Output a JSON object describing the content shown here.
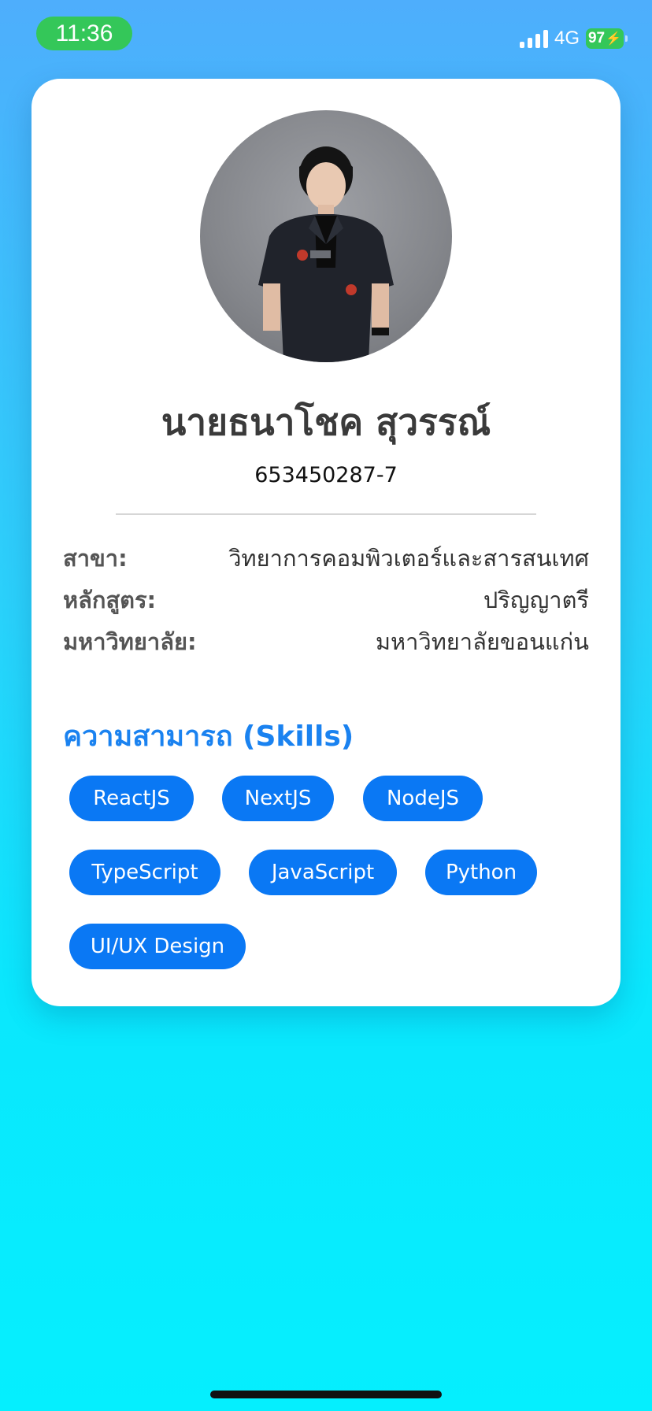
{
  "status_bar": {
    "time": "11:36",
    "network": "4G",
    "battery": "97",
    "colors": {
      "pill": "#34c759",
      "battery": "#34c759"
    }
  },
  "profile": {
    "name": "นายธนาโชค สุวรรณ์",
    "student_id": "653450287-7",
    "info": [
      {
        "label": "สาขา:",
        "value": "วิทยาการคอมพิวเตอร์และสารสนเทศ"
      },
      {
        "label": "หลักสูตร:",
        "value": "ปริญญาตรี"
      },
      {
        "label": "มหาวิทยาลัย:",
        "value": "มหาวิทยาลัยขอนแก่น"
      }
    ]
  },
  "skills": {
    "title": "ความสามารถ (Skills)",
    "items": [
      "ReactJS",
      "NextJS",
      "NodeJS",
      "TypeScript",
      "JavaScript",
      "Python",
      "UI/UX Design"
    ]
  },
  "theme": {
    "accent": "#0a78f4",
    "title_color": "#1a82f0",
    "card": "#ffffff"
  }
}
